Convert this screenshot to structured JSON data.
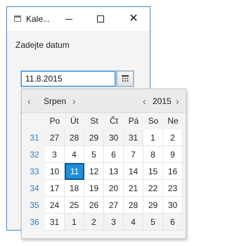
{
  "window": {
    "title": "Kale..."
  },
  "form": {
    "label": "Zadejte datum",
    "date_value": "11.8.2015"
  },
  "calendar": {
    "month": "Srpen",
    "year": "2015",
    "arrows": {
      "prev": "‹",
      "next": "›"
    },
    "weekday_headers": [
      "Po",
      "Út",
      "St",
      "Čt",
      "Pá",
      "So",
      "Ne"
    ],
    "selected_day": "11",
    "weeks": [
      {
        "week": "31",
        "days": [
          "27",
          "28",
          "29",
          "30",
          "31",
          "1",
          "2"
        ]
      },
      {
        "week": "32",
        "days": [
          "3",
          "4",
          "5",
          "6",
          "7",
          "8",
          "9"
        ]
      },
      {
        "week": "33",
        "days": [
          "10",
          "11",
          "12",
          "13",
          "14",
          "15",
          "16"
        ]
      },
      {
        "week": "34",
        "days": [
          "17",
          "18",
          "19",
          "20",
          "21",
          "22",
          "23"
        ]
      },
      {
        "week": "35",
        "days": [
          "24",
          "25",
          "26",
          "27",
          "28",
          "29",
          "30"
        ]
      },
      {
        "week": "36",
        "days": [
          "31",
          "1",
          "2",
          "3",
          "4",
          "5",
          "6"
        ]
      }
    ]
  },
  "colors": {
    "accent": "#1f90d8",
    "week_number": "#2a7fc9",
    "window_border": "#4a90d6"
  }
}
